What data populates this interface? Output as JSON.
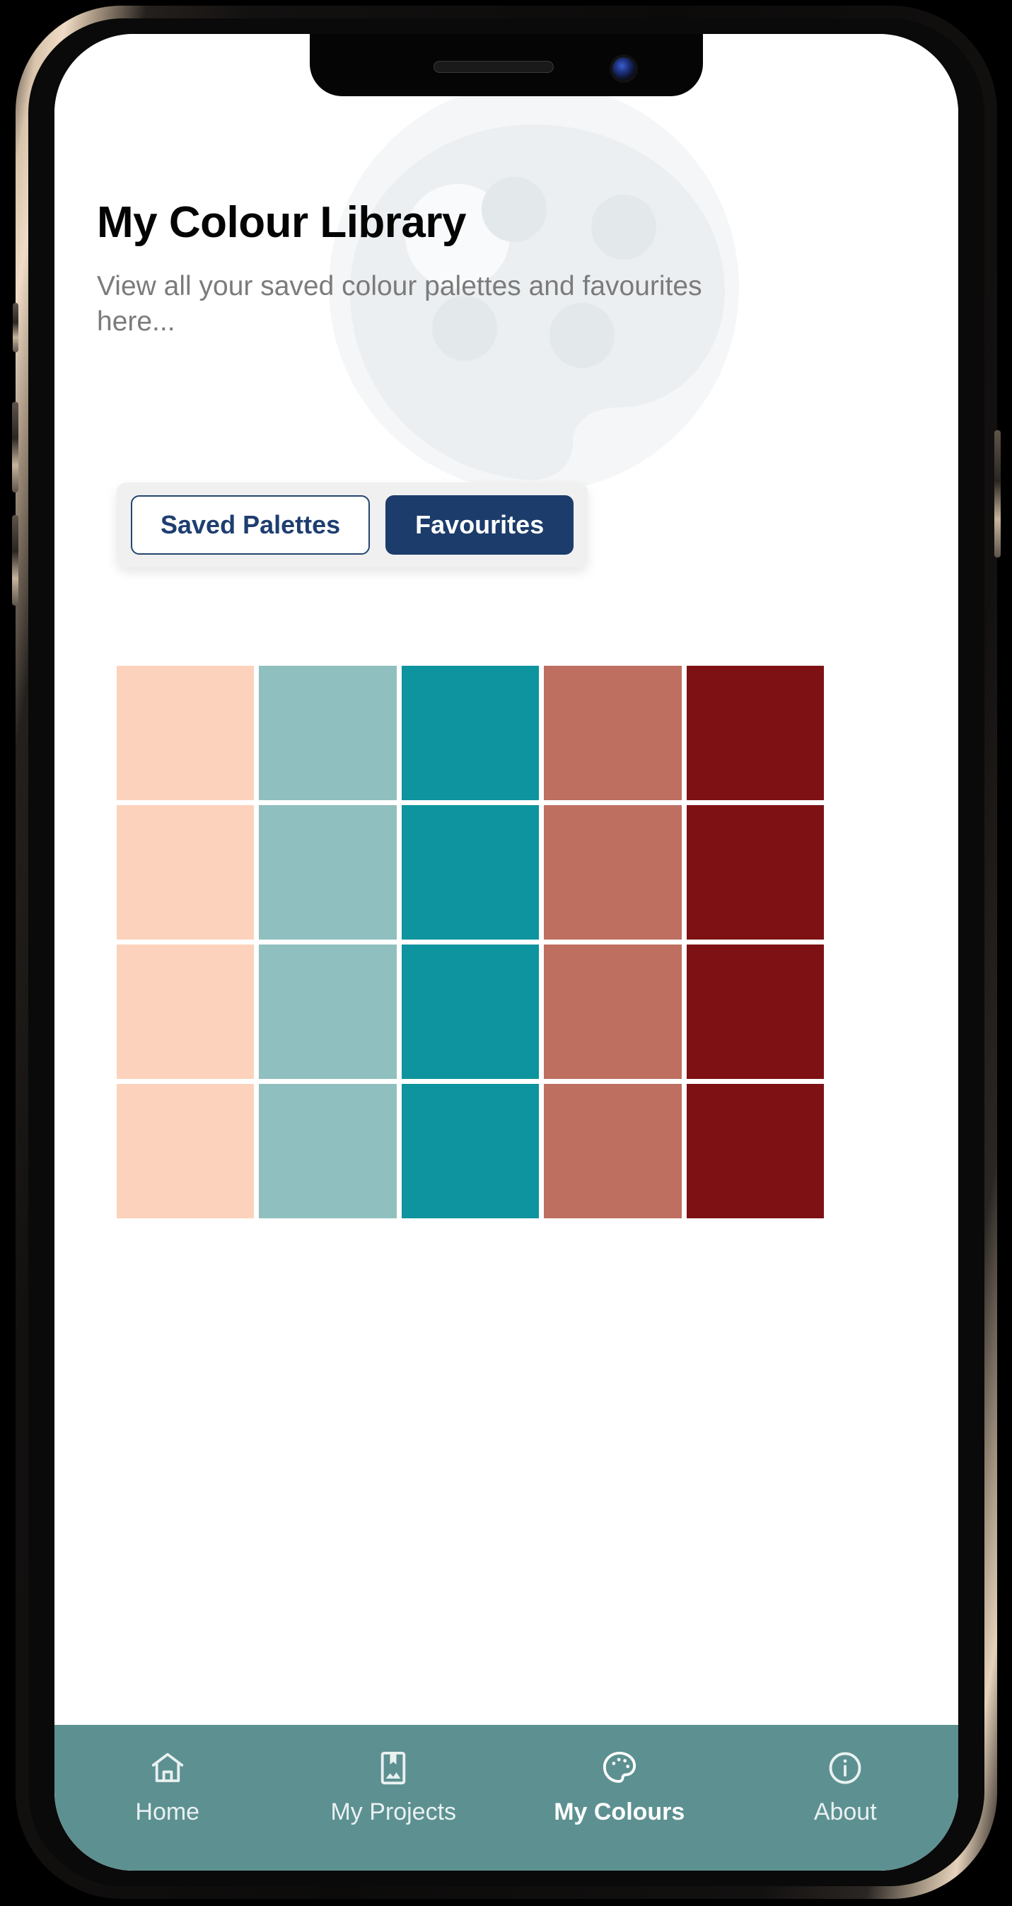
{
  "header": {
    "title": "My Colour Library",
    "subtitle": "View all your saved colour palettes and favourites here..."
  },
  "tabs": [
    {
      "label": "Saved Palettes",
      "active": false
    },
    {
      "label": "Favourites",
      "active": true
    }
  ],
  "theme": {
    "navy": "#1c3c6b",
    "nav_bar": "#5d9091",
    "tab_track": "#f0f0f0",
    "watermark": "#eceff1"
  },
  "swatch_grid": {
    "columns": 5,
    "rows": 4,
    "column_colors": [
      "#fdd2bc",
      "#8fbfbe",
      "#0e949e",
      "#be6f60",
      "#7e1113"
    ],
    "rows_data": [
      [
        "#fdd2bc",
        "#8fbfbe",
        "#0e949e",
        "#be6f60",
        "#7e1113"
      ],
      [
        "#fdd2bc",
        "#8fbfbe",
        "#0e949e",
        "#be6f60",
        "#7e1113"
      ],
      [
        "#fdd2bc",
        "#8fbfbe",
        "#0e949e",
        "#be6f60",
        "#7e1113"
      ],
      [
        "#fdd2bc",
        "#8fbfbe",
        "#0e949e",
        "#be6f60",
        "#7e1113"
      ]
    ]
  },
  "bottom_nav": [
    {
      "label": "Home",
      "icon": "home-icon",
      "active": false
    },
    {
      "label": "My Projects",
      "icon": "book-icon",
      "active": false
    },
    {
      "label": "My Colours",
      "icon": "palette-icon",
      "active": true
    },
    {
      "label": "About",
      "icon": "info-icon",
      "active": false
    }
  ],
  "device": {
    "speaker": "speaker-grille",
    "camera": "front-camera"
  }
}
